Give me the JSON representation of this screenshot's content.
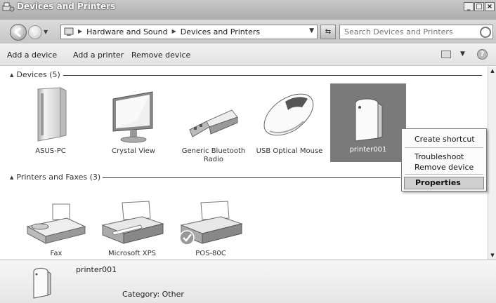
{
  "window": {
    "title": "Devices and Printers",
    "min": "_",
    "max": "□",
    "close": "×"
  },
  "nav": {
    "breadcrumbs": [
      "Hardware and Sound",
      "Devices and Printers"
    ],
    "search_placeholder": "Search Devices and Printers"
  },
  "commands": {
    "add_device": "Add a device",
    "add_printer": "Add a printer",
    "remove_device": "Remove device"
  },
  "groups": {
    "devices": {
      "label": "Devices (5)"
    },
    "printers": {
      "label": "Printers and Faxes (3)"
    }
  },
  "devices": [
    {
      "name": "ASUS-PC"
    },
    {
      "name": "Crystal View"
    },
    {
      "name": "Generic Bluetooth Radio"
    },
    {
      "name": "USB Optical Mouse"
    },
    {
      "name": "printer001"
    }
  ],
  "printers": [
    {
      "name": "Fax"
    },
    {
      "name": "Microsoft XPS"
    },
    {
      "name": "POS-80C"
    }
  ],
  "context_menu": {
    "create_shortcut": "Create shortcut",
    "troubleshoot": "Troubleshoot",
    "remove_device": "Remove device",
    "properties": "Properties"
  },
  "details": {
    "name": "printer001",
    "category": "Category:  Other"
  }
}
